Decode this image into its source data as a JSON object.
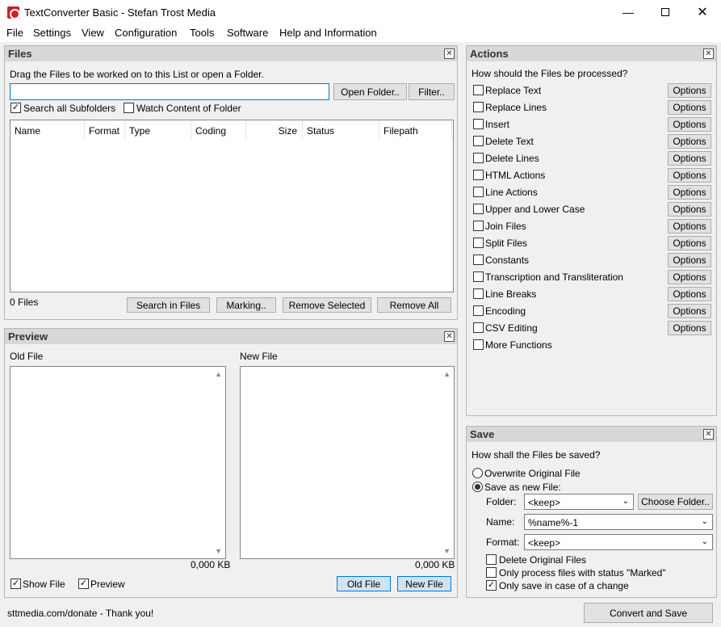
{
  "window": {
    "title": "TextConverter Basic - Stefan Trost Media",
    "minimize_icon": "minimize-icon",
    "maximize_icon": "maximize-icon",
    "close_icon": "close-icon"
  },
  "menu": [
    "File",
    "Settings",
    "View",
    "Configuration",
    "Tools",
    "Software",
    "Help and Information"
  ],
  "files": {
    "title": "Files",
    "hint": "Drag the Files to be worked on to this List or open a Folder.",
    "path_value": "",
    "open_folder": "Open Folder..",
    "filter": "Filter..",
    "search_subfolders": "Search all Subfolders",
    "watch_folder": "Watch Content of Folder",
    "columns": [
      "Name",
      "Format",
      "Type",
      "Coding",
      "Size",
      "Status",
      "Filepath"
    ],
    "count": "0 Files",
    "search_in_files": "Search in Files",
    "marking": "Marking..",
    "remove_selected": "Remove Selected",
    "remove_all": "Remove All"
  },
  "preview": {
    "title": "Preview",
    "old_file_label": "Old File",
    "new_file_label": "New File",
    "old_size": "0,000 KB",
    "new_size": "0,000 KB",
    "show_file": "Show File",
    "preview": "Preview",
    "old_file_btn": "Old File",
    "new_file_btn": "New File"
  },
  "actions": {
    "title": "Actions",
    "question": "How should the Files be processed?",
    "options_label": "Options",
    "items": [
      "Replace Text",
      "Replace Lines",
      "Insert",
      "Delete Text",
      "Delete Lines",
      "HTML Actions",
      "Line Actions",
      "Upper and Lower Case",
      "Join Files",
      "Split Files",
      "Constants",
      "Transcription and Transliteration",
      "Line Breaks",
      "Encoding",
      "CSV Editing",
      "More Functions"
    ]
  },
  "save": {
    "title": "Save",
    "question": "How shall the Files be saved?",
    "overwrite": "Overwrite Original File",
    "save_new": "Save as new File:",
    "folder_label": "Folder:",
    "folder_value": "<keep>",
    "choose_folder": "Choose Folder..",
    "name_label": "Name:",
    "name_value": "%name%-1",
    "format_label": "Format:",
    "format_value": "<keep>",
    "delete_original": "Delete Original Files",
    "only_marked": "Only process files with status \"Marked\"",
    "only_change": "Only save in case of a change"
  },
  "status": {
    "donate": "sttmedia.com/donate - Thank you!",
    "convert": "Convert and Save"
  }
}
